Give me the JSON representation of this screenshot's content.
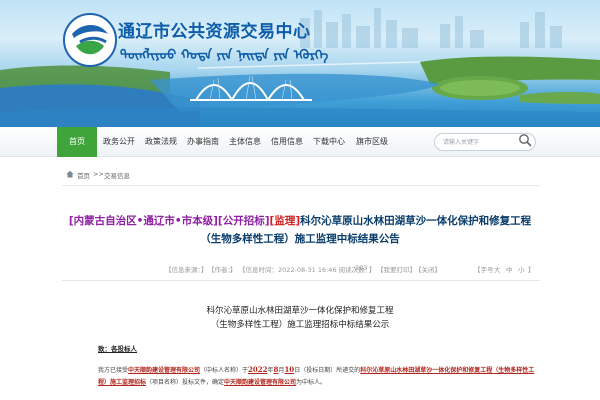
{
  "site": {
    "title": "通辽市公共资源交易中心",
    "mongolian_subtitle": "ᠲᠦᠩᠯᠢᠶᠣᠣ ᠬᠣᠲᠠ ᠶᠢᠨ ᠨᠡᠢᠲᠡ ᠶᠢᠨ ᠡᠬᠦᠷᠭᠡ"
  },
  "nav": {
    "items": [
      {
        "label": "首页",
        "active": true
      },
      {
        "label": "政务公开",
        "active": false
      },
      {
        "label": "政策法规",
        "active": false
      },
      {
        "label": "办事指南",
        "active": false
      },
      {
        "label": "主体信息",
        "active": false
      },
      {
        "label": "信用信息",
        "active": false
      },
      {
        "label": "下载中心",
        "active": false
      },
      {
        "label": "旗市区级",
        "active": false
      }
    ],
    "search": {
      "placeholder": "请输入关键字",
      "icon": "search-icon"
    },
    "accent_color": "#3fa53a"
  },
  "breadcrumb": {
    "home": "首页",
    "separator": ">>",
    "current": "交易信息"
  },
  "article": {
    "title_tags": [
      "[内蒙古自治区•通辽市•市本级]",
      "[公开招标]",
      "[监理]"
    ],
    "title_main": "科尔沁草原山水林田湖草沙一体化保护和修复工程（生物多样性工程）施工监理中标结果公告",
    "meta": {
      "source": "【信息来源：",
      "source_close": "】",
      "author": "【作者：",
      "author_close": "】",
      "time": "【信息时间：2022-08-31 16:46 阅读次数：",
      "views": "293",
      "time_close": "】",
      "print": "【我要打印】",
      "close": "【关闭】"
    },
    "font_size": {
      "label": "【字号",
      "large": "大",
      "medium": "中",
      "small": "小",
      "close": "】"
    }
  },
  "document": {
    "title_line1": "科尔沁草原山水林田湖草沙一体化保护和修复工程",
    "title_line2": "（生物多样性工程）施工监理招标中标结果公示",
    "salutation": "致：各投标人",
    "para_p1": "我方已接受",
    "company": "中天顺韵建设管理有限公司",
    "para_p2": "（中标人名称）于",
    "year": "2022",
    "ch_year": "年",
    "month": "8",
    "ch_month": "月",
    "day": "10",
    "para_p3": "日（投标日期）所递交的",
    "project": "科尔沁草原山水林田湖草沙一体化保护和修复工程（生物多样性工程）施工监理招标",
    "para_p4": "（项目名称）投标文件，确定",
    "company2": "中天顺韵建设管理有限公司",
    "para_p5": "为中标人。"
  }
}
